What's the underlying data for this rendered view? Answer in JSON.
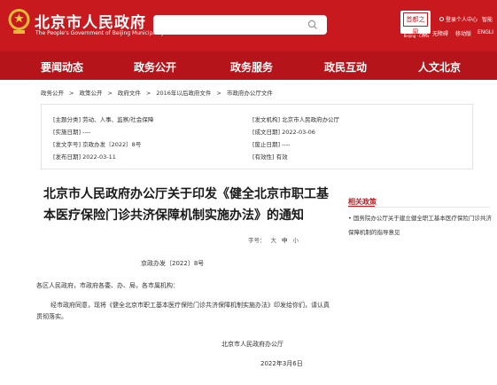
{
  "header": {
    "title": "北京市人民政府",
    "subtitle": "The People's Government of Beijing Municipality",
    "search_placeholder": "",
    "logo_text": "首都之窗",
    "logo_caption": "Beijing · China",
    "links": {
      "personal": "登录个人中心",
      "smart": "智能",
      "accessible": "无障碍",
      "mobile": "移动版",
      "english": "ENGLI"
    }
  },
  "nav": {
    "items": [
      "要闻动态",
      "政务公开",
      "政务服务",
      "政民互动",
      "人文北京"
    ]
  },
  "breadcrumb": [
    "政务公开",
    "政策公开",
    "政府文件",
    "2016年以后政府文件",
    "市政府办公厅文件"
  ],
  "meta": {
    "topic": "[主题分类] 劳动、人事、监察/社会保障",
    "issuer": "[发文机构] 北京市人民政府办公厅",
    "effective": "[实施日期] ----",
    "formed": "[成文日期] 2022-03-06",
    "doc_no": "[发文字号] 京政办发〔2022〕8号",
    "repeal": "[废止日期] ----",
    "publish": "[发布日期] 2022-03-11",
    "validity": "[有效性] 有效"
  },
  "article": {
    "title": "北京市人民政府办公厅关于印发《健全北京市职工基本医疗保险门诊共济保障机制实施办法》的通知",
    "fontsize_label": "字号：",
    "fontsize_options": [
      "大",
      "中",
      "小"
    ],
    "doc_number": "京政办发〔2022〕8号",
    "salutation": "各区人民政府，市政府各委、办、局，各市属机构：",
    "body": "经市政府同意，现将《健全北京市职工基本医疗保险门诊共济保障机制实施办法》印发给你们，请认真贯彻落实。",
    "signer": "北京市人民政府办公厅",
    "date": "2022年3月6日"
  },
  "sidebar": {
    "related_title": "相关政策",
    "items": [
      "• 国务院办公厅关于建立健全职工基本医疗保险门诊共济保障机制的指导意见"
    ]
  },
  "colors": {
    "brand_red": "#c8191e",
    "nav_red": "#b5151a"
  }
}
